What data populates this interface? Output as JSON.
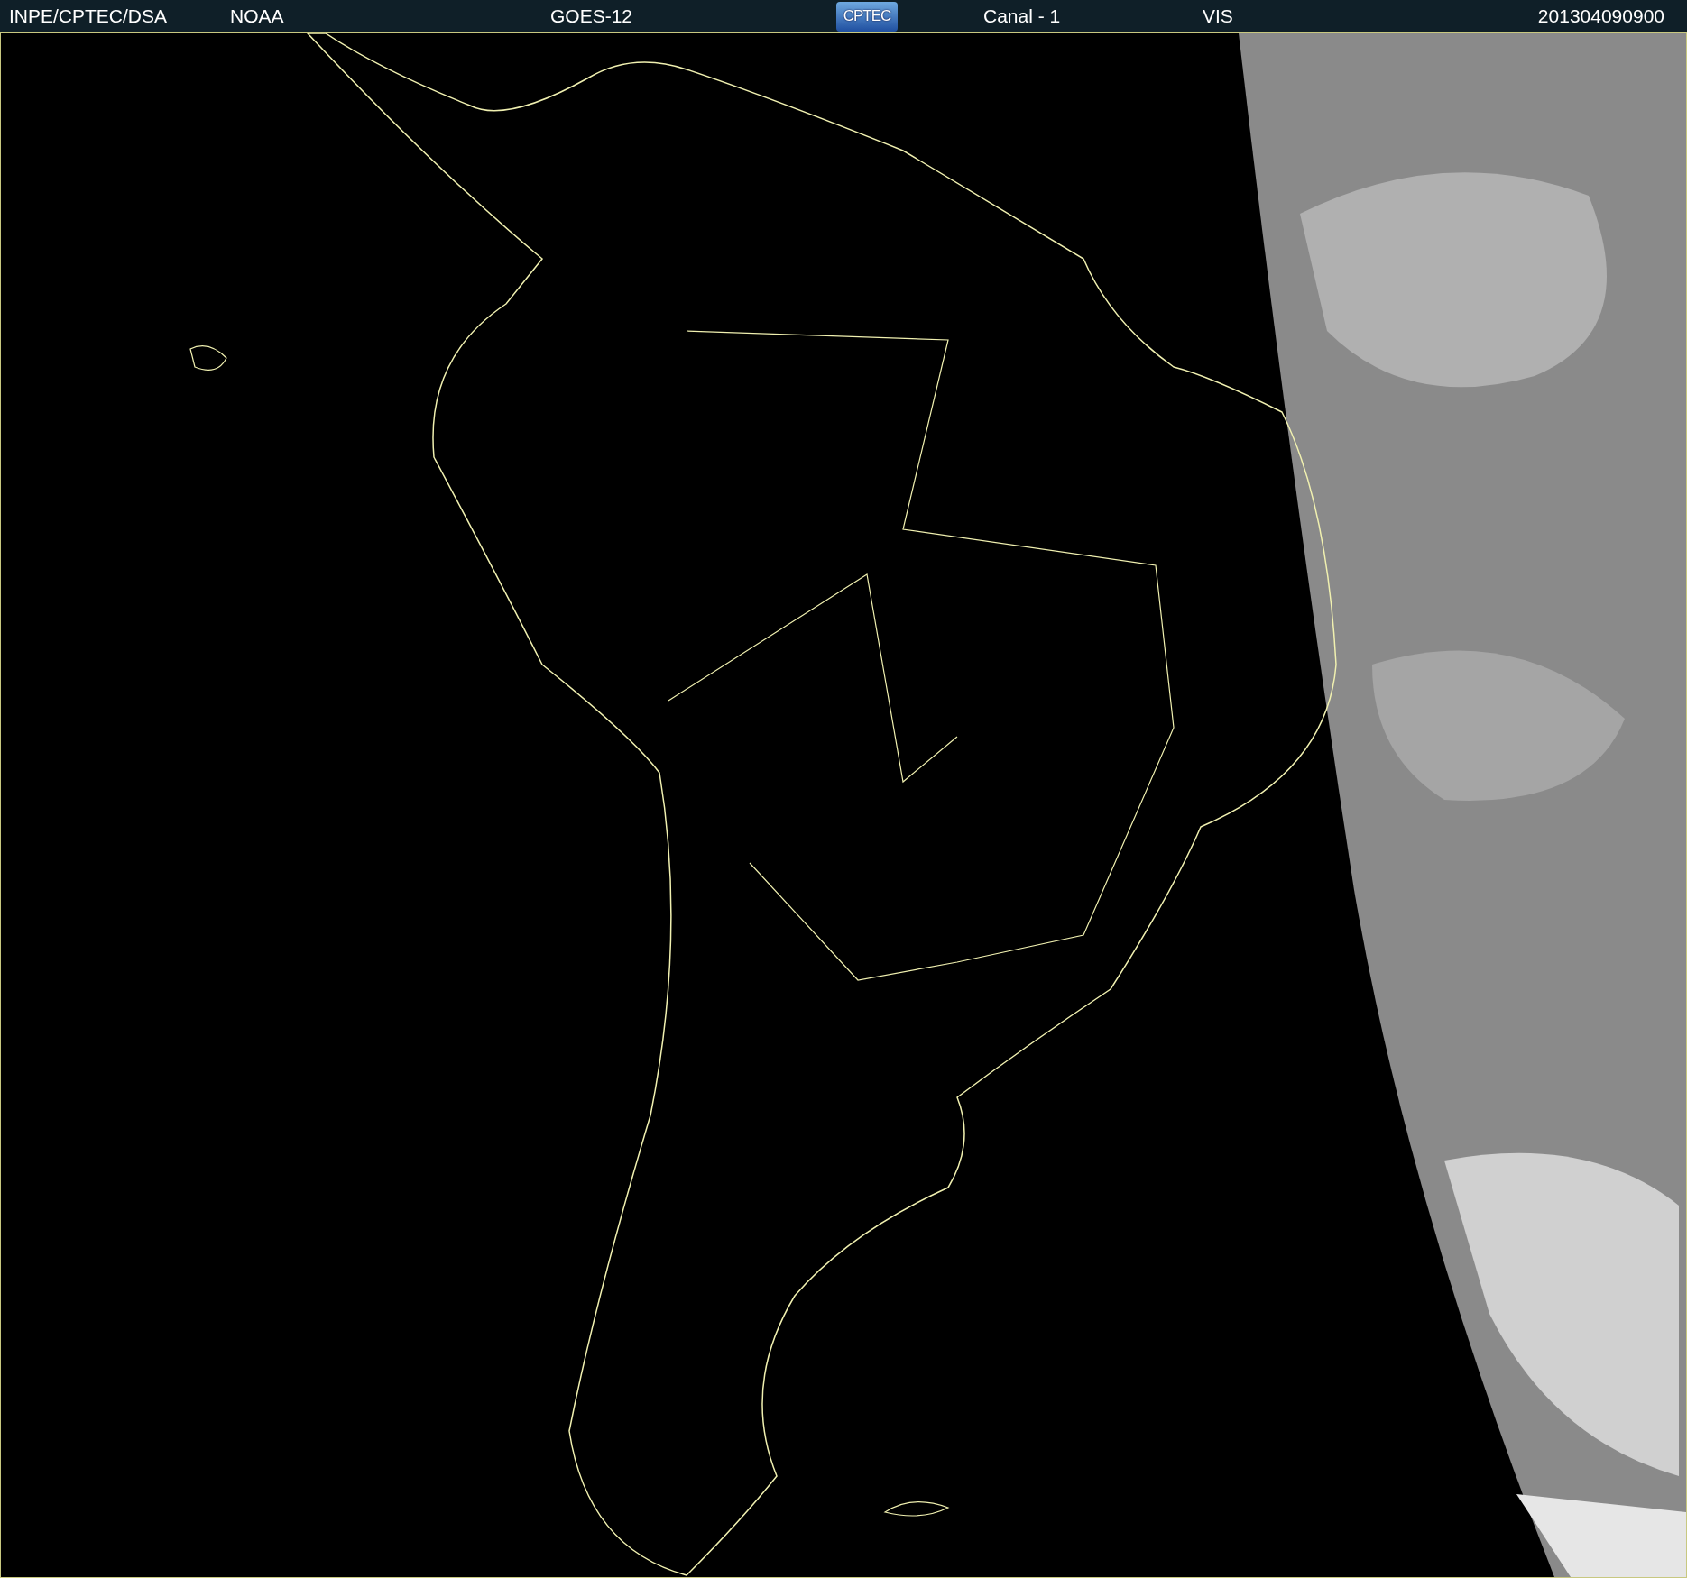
{
  "header": {
    "institution": "INPE/CPTEC/DSA",
    "agency": "NOAA",
    "satellite": "GOES-12",
    "logo": "CPTEC",
    "channel": "Canal - 1",
    "band": "VIS",
    "timestamp": "201304090900"
  }
}
